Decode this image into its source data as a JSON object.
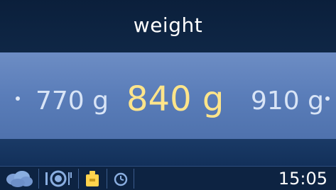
{
  "header": {
    "title": "weight"
  },
  "selector": {
    "previous": "770 g",
    "current": "840 g",
    "next": "910 g"
  },
  "footer": {
    "icons": [
      "steam-icon",
      "plate-cutlery-icon",
      "weight-icon",
      "timer-icon"
    ],
    "time": "15:05"
  },
  "colors": {
    "accent": "#ffe58a",
    "band": "#5a7db9",
    "background": "#0f2746"
  }
}
